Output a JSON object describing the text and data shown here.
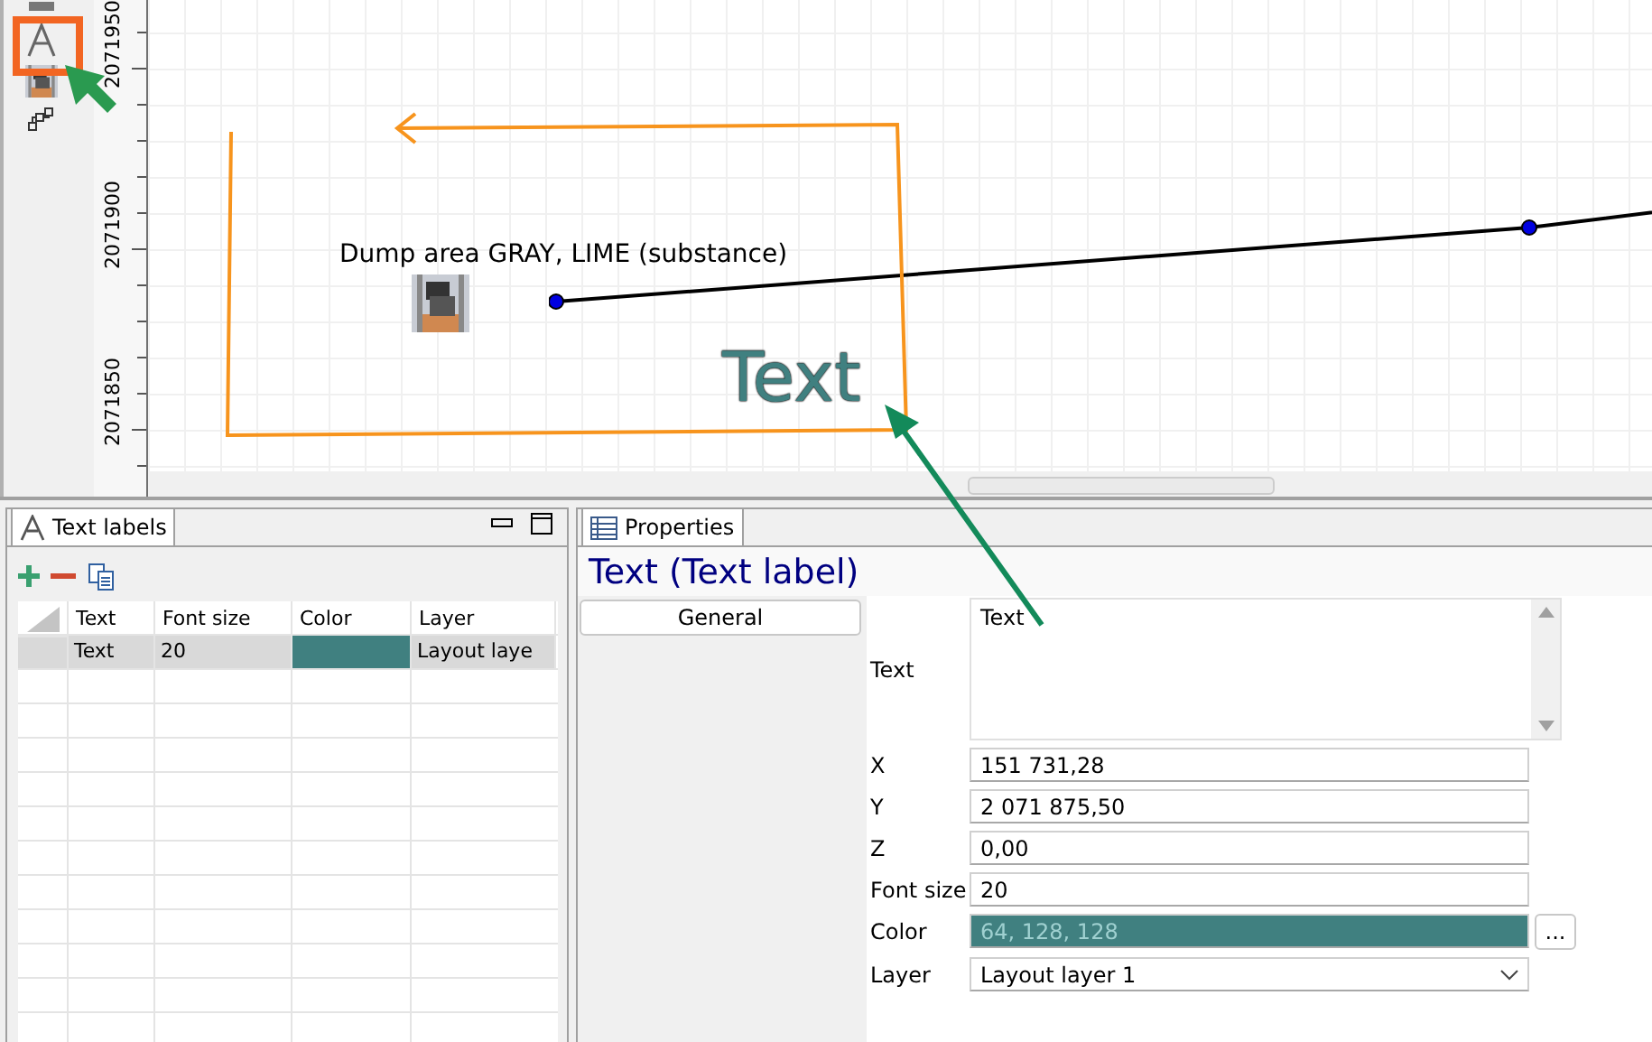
{
  "toolbar": {
    "tools": [
      {
        "kind": "partial"
      },
      {
        "kind": "text"
      },
      {
        "kind": "dump"
      },
      {
        "kind": "network"
      }
    ]
  },
  "map": {
    "y_ticks": [
      "2071950",
      "2071900",
      "2071850"
    ],
    "object_label": "Dump area GRAY, LIME (substance)",
    "text_label": {
      "text": "Text",
      "color": "#408080"
    }
  },
  "labels_panel": {
    "tab": "Text labels",
    "columns": [
      "Text",
      "Font size",
      "Color",
      "Layer"
    ],
    "rows": [
      {
        "text": "Text",
        "font_size": "20",
        "color": "#408080",
        "layer": "Layout laye",
        "selected": true
      }
    ]
  },
  "properties": {
    "tab": "Properties",
    "title": "Text (Text label)",
    "groups": [
      {
        "label": "General",
        "selected": true
      }
    ],
    "fields": [
      {
        "kind": "textarea",
        "label": "Text",
        "value": "Text"
      },
      {
        "kind": "input",
        "label": "X",
        "value": "151 731,28"
      },
      {
        "kind": "input",
        "label": "Y",
        "value": "2 071 875,50"
      },
      {
        "kind": "input",
        "label": "Z",
        "value": "0,00"
      },
      {
        "kind": "input",
        "label": "Font size",
        "value": "20"
      },
      {
        "kind": "color",
        "label": "Color",
        "value": "64, 128, 128",
        "color": "#408080",
        "button": "..."
      },
      {
        "kind": "select",
        "label": "Layer",
        "value": "Layout layer 1"
      }
    ]
  }
}
